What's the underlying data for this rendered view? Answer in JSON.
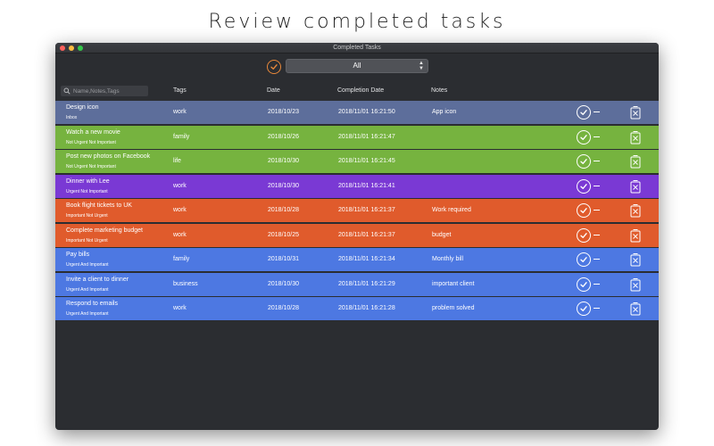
{
  "headline": "Review completed tasks",
  "window": {
    "title": "Completed Tasks"
  },
  "toolbar": {
    "filter_value": "All"
  },
  "search": {
    "placeholder": "Name,Notes,Tags"
  },
  "columns": {
    "tags": "Tags",
    "date": "Date",
    "completion": "Completion Date",
    "notes": "Notes"
  },
  "colors": {
    "inbox": "#5d6e9b",
    "not_urgent_not_important": "#76b33f",
    "urgent_not_important": "#7a39d4",
    "important_not_urgent": "#e05b2c",
    "urgent_and_important": "#4d78e2",
    "accent": "#e8883a"
  },
  "tasks": [
    {
      "title": "Design icon",
      "priority": "Inbox",
      "tags": "work",
      "date": "2018/10/23",
      "completion": "2018/11/01 16:21:50",
      "notes": "App icon",
      "color": "#5d6e9b"
    },
    {
      "title": "Watch a new movie",
      "priority": "Not Urgent Not Important",
      "tags": "family",
      "date": "2018/10/26",
      "completion": "2018/11/01 16:21:47",
      "notes": "",
      "color": "#76b33f"
    },
    {
      "title": "Post new photos on Facebook",
      "priority": "Not Urgent Not Important",
      "tags": "life",
      "date": "2018/10/30",
      "completion": "2018/11/01 16:21:45",
      "notes": "",
      "color": "#76b33f"
    },
    {
      "title": "Dinner with Lee",
      "priority": "Urgent Not Important",
      "tags": "work",
      "date": "2018/10/30",
      "completion": "2018/11/01 16:21:41",
      "notes": "",
      "color": "#7a39d4"
    },
    {
      "title": "Book flight tickets to UK",
      "priority": "Important Not Urgent",
      "tags": "work",
      "date": "2018/10/28",
      "completion": "2018/11/01 16:21:37",
      "notes": "Work required",
      "color": "#e05b2c"
    },
    {
      "title": "Complete marketing budget",
      "priority": "Important Not Urgent",
      "tags": "work",
      "date": "2018/10/25",
      "completion": "2018/11/01 16:21:37",
      "notes": "budget",
      "color": "#e05b2c"
    },
    {
      "title": "Pay bills",
      "priority": "Urgent And Important",
      "tags": "family",
      "date": "2018/10/31",
      "completion": "2018/11/01 16:21:34",
      "notes": "Monthly bill",
      "color": "#4d78e2"
    },
    {
      "title": "Invite a client to dinner",
      "priority": "Urgent And Important",
      "tags": "business",
      "date": "2018/10/30",
      "completion": "2018/11/01 16:21:29",
      "notes": "important client",
      "color": "#4d78e2"
    },
    {
      "title": "Respond to emails",
      "priority": "Urgent And Important",
      "tags": "work",
      "date": "2018/10/28",
      "completion": "2018/11/01 16:21:28",
      "notes": "problem solved",
      "color": "#4d78e2"
    }
  ]
}
